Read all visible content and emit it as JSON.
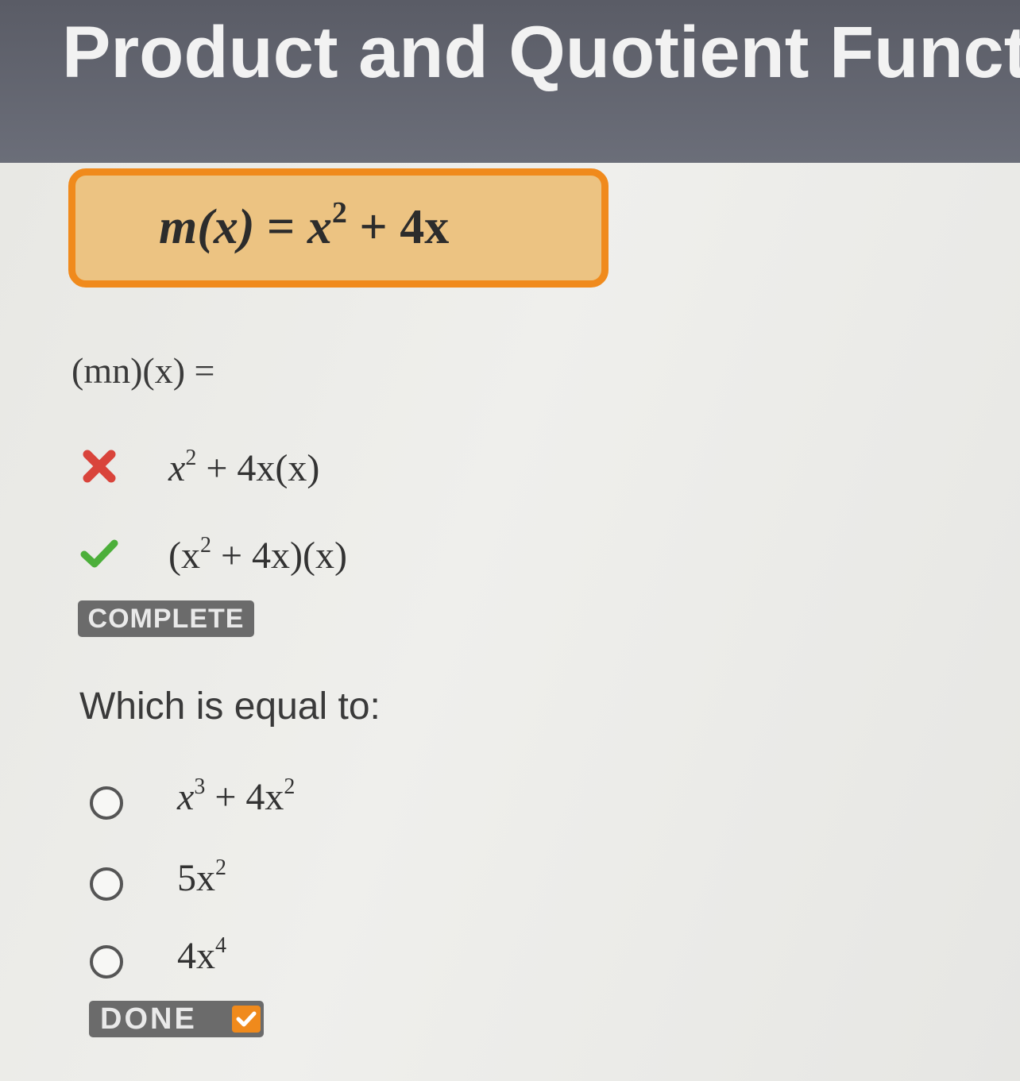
{
  "header": {
    "title": "Product and Quotient Functi"
  },
  "function_box": {
    "lhs": "m(x)",
    "eq": " = ",
    "base": "x",
    "exp": "2",
    "rest": " + 4x"
  },
  "prompt": "(mn)(x) =",
  "answers": [
    {
      "status": "incorrect",
      "icon": "x-mark-icon",
      "base": "x",
      "exp": "2",
      "rest": " + 4x(x)",
      "prefix": ""
    },
    {
      "status": "correct",
      "icon": "check-mark-icon",
      "prefix": "(x",
      "exp": "2",
      "rest": " + 4x)(x)"
    }
  ],
  "complete_badge": "COMPLETE",
  "question": "Which is equal to:",
  "options": [
    {
      "a": "x",
      "a_exp": "3",
      "b": " + 4x",
      "b_exp": "2"
    },
    {
      "a": "5x",
      "a_exp": "2"
    },
    {
      "a": "4x",
      "a_exp": "4"
    }
  ],
  "done_badge": "DONE",
  "colors": {
    "header": "#5f616b",
    "accent_orange": "#f08a1c",
    "box_fill": "#ecc382",
    "incorrect_red": "#d9443b",
    "correct_green": "#4caf3a",
    "badge_gray": "#6b6b6b"
  }
}
